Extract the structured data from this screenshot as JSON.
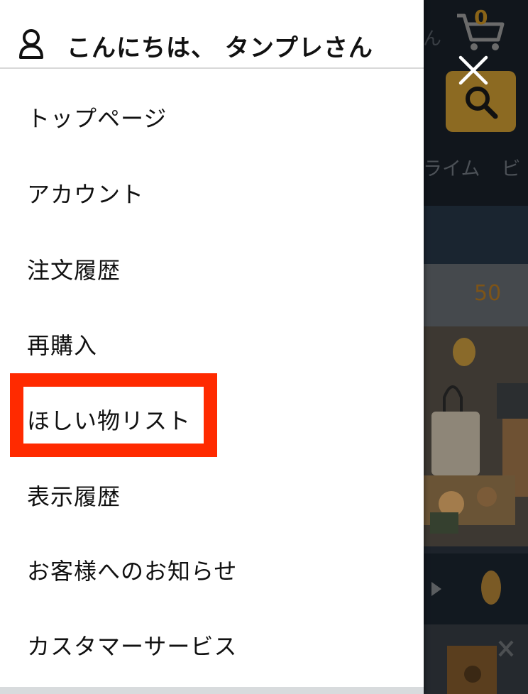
{
  "background": {
    "greeting_fragment": "ん",
    "cart_count": "0",
    "tabs": [
      "ライム",
      "ビ"
    ],
    "price_fragment": "50"
  },
  "drawer": {
    "greeting": "こんにちは、 タンプレさん",
    "menu_items": [
      {
        "label": "トップページ"
      },
      {
        "label": "アカウント"
      },
      {
        "label": "注文履歴"
      },
      {
        "label": "再購入"
      },
      {
        "label": "ほしい物リスト"
      },
      {
        "label": "表示履歴"
      },
      {
        "label": "お客様へのお知らせ"
      },
      {
        "label": "カスタマーサービス"
      }
    ]
  },
  "colors": {
    "highlight": "#ff2a00",
    "accent": "#febd69"
  }
}
